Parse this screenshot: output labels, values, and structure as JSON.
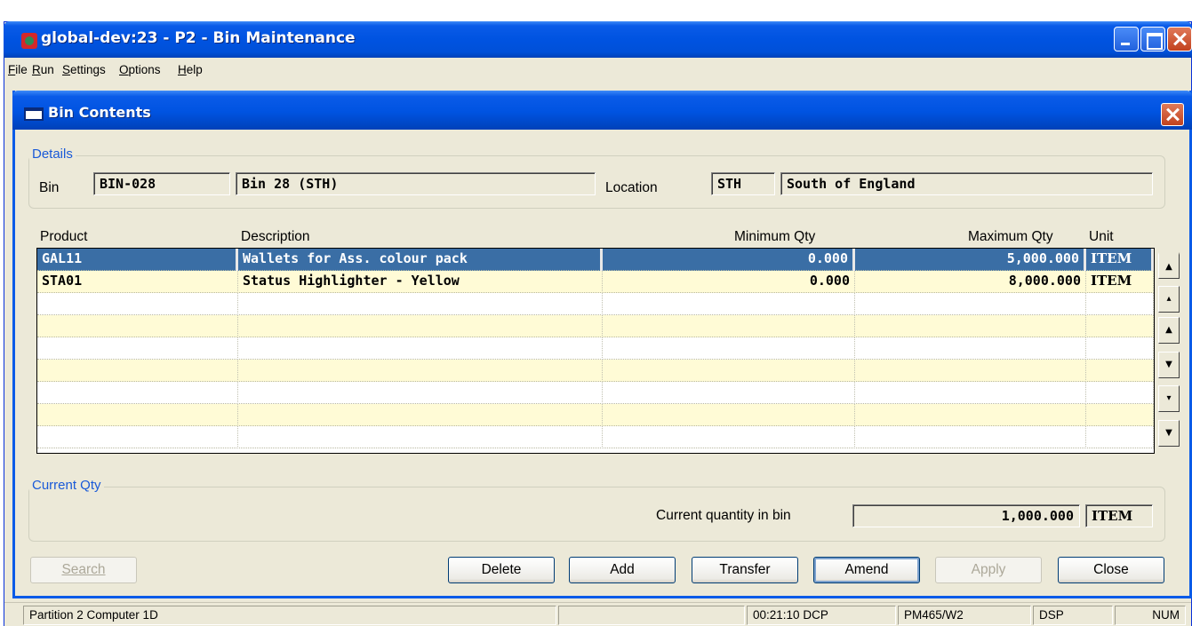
{
  "app": {
    "title": "global-dev:23 - P2 - Bin Maintenance"
  },
  "menu": [
    "File",
    "Run",
    "Settings",
    "Options",
    "Help"
  ],
  "dialog": {
    "title": "Bin Contents"
  },
  "details": {
    "legend": "Details",
    "bin_label": "Bin",
    "bin_code": "BIN-028",
    "bin_name": "Bin 28 (STH)",
    "location_label": "Location",
    "location_code": "STH",
    "location_name": "South of England"
  },
  "grid": {
    "headers": [
      "Product",
      "Description",
      "Minimum Qty",
      "Maximum Qty",
      "Unit"
    ],
    "rows": [
      {
        "product": "GAL11",
        "description": "Wallets for Ass. colour pack",
        "min_qty": "0.000",
        "max_qty": "5,000.000",
        "unit": "ITEM"
      },
      {
        "product": "STA01",
        "description": "Status Highlighter - Yellow",
        "min_qty": "0.000",
        "max_qty": "8,000.000",
        "unit": "ITEM"
      },
      {
        "product": "",
        "description": "",
        "min_qty": "",
        "max_qty": "",
        "unit": ""
      },
      {
        "product": "",
        "description": "",
        "min_qty": "",
        "max_qty": "",
        "unit": ""
      },
      {
        "product": "",
        "description": "",
        "min_qty": "",
        "max_qty": "",
        "unit": ""
      },
      {
        "product": "",
        "description": "",
        "min_qty": "",
        "max_qty": "",
        "unit": ""
      },
      {
        "product": "",
        "description": "",
        "min_qty": "",
        "max_qty": "",
        "unit": ""
      },
      {
        "product": "",
        "description": "",
        "min_qty": "",
        "max_qty": "",
        "unit": ""
      },
      {
        "product": "",
        "description": "",
        "min_qty": "",
        "max_qty": "",
        "unit": ""
      }
    ],
    "scroll_icons": [
      "scroll-top-icon",
      "page-up-icon",
      "line-up-icon",
      "line-down-icon",
      "page-down-icon",
      "scroll-bottom-icon"
    ]
  },
  "current_qty": {
    "legend": "Current Qty",
    "label": "Current quantity in bin",
    "value": "1,000.000",
    "unit": "ITEM"
  },
  "buttons": {
    "search": "Search",
    "delete": "Delete",
    "add": "Add",
    "transfer": "Transfer",
    "amend": "Amend",
    "apply": "Apply",
    "close": "Close"
  },
  "status": {
    "partition": "Partition 2 Computer 1D",
    "time": "00:21:10",
    "dcp": "DCP",
    "terminal": "PM465/W2",
    "dsp": "DSP",
    "num": "NUM"
  },
  "colors": {
    "title_bar": "#0053e1",
    "selected_row": "#3a6ea5",
    "alt_row": "#fffbd6",
    "legend_text": "#1a5ad8"
  }
}
